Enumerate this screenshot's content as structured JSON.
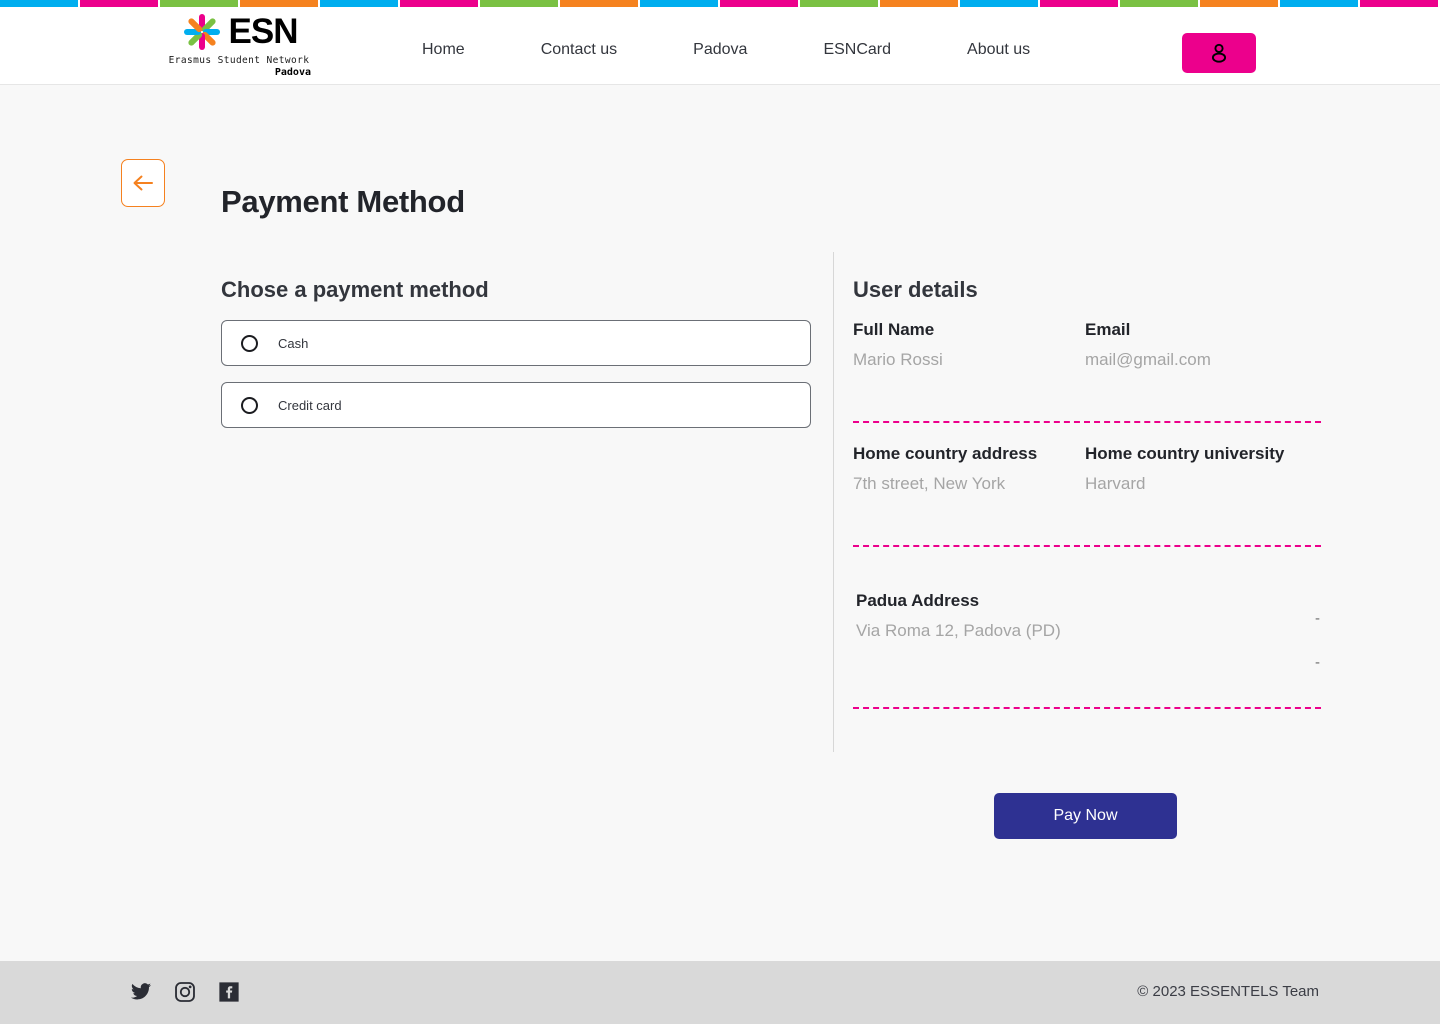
{
  "topbar": {
    "colors": [
      "#00aeef",
      "#ec008c",
      "#7ac143",
      "#f5821f"
    ],
    "segment_count": 18
  },
  "header": {
    "logo": {
      "name": "ESN",
      "subtitle": "Erasmus Student Network",
      "city": "Padova",
      "star_colors": [
        "#ec008c",
        "#7ac143",
        "#00aeef",
        "#f5821f",
        "#ec008c",
        "#7ac143",
        "#00aeef",
        "#f5821f"
      ]
    },
    "nav": [
      {
        "label": "Home",
        "name": "nav-home"
      },
      {
        "label": "Contact us",
        "name": "nav-contact-us"
      },
      {
        "label": "Padova",
        "name": "nav-padova"
      },
      {
        "label": "ESNCard",
        "name": "nav-esncard"
      },
      {
        "label": "About us",
        "name": "nav-about-us"
      }
    ],
    "account_button": {
      "icon": "user-icon",
      "color": "#ec008c"
    }
  },
  "page": {
    "back_button": {
      "icon": "arrow-left-icon",
      "border_color": "#f5811f"
    },
    "title": "Payment Method"
  },
  "payment": {
    "heading": "Chose a payment method",
    "options": [
      {
        "label": "Cash",
        "selected": false
      },
      {
        "label": "Credit card",
        "selected": false
      }
    ]
  },
  "user_details": {
    "heading": "User details",
    "blocks": [
      {
        "fields": [
          {
            "key": "Full Name",
            "value": "Mario Rossi"
          },
          {
            "key": "Email",
            "value": "mail@gmail.com"
          }
        ]
      },
      {
        "fields": [
          {
            "key": "Home country address",
            "value": "7th street, New York"
          },
          {
            "key": "Home country university",
            "value": "Harvard"
          }
        ]
      },
      {
        "fields": [
          {
            "key": "Padua Address",
            "value": "Via Roma 12, Padova (PD)"
          }
        ]
      }
    ],
    "blank_marks": [
      "-",
      "-"
    ],
    "divider_color": "#ec008c"
  },
  "actions": {
    "pay_now_label": "Pay Now",
    "pay_now_color": "#2e3192"
  },
  "footer": {
    "social": [
      {
        "name": "twitter-icon",
        "label": "Twitter"
      },
      {
        "name": "instagram-icon",
        "label": "Instagram"
      },
      {
        "name": "facebook-icon",
        "label": "Facebook"
      }
    ],
    "copyright": "© 2023 ESSENTELS Team"
  }
}
